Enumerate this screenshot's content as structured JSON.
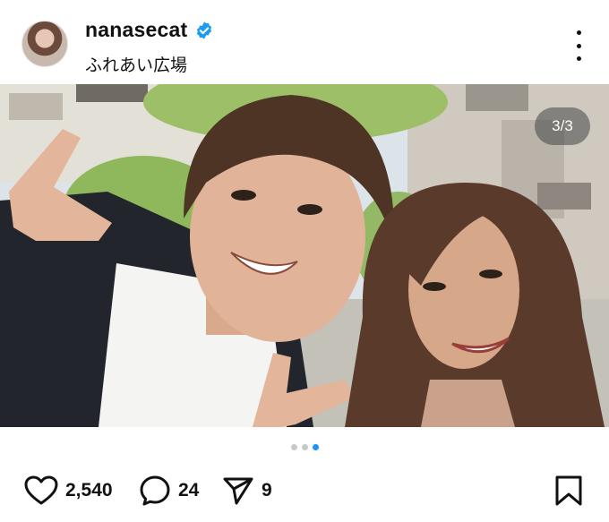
{
  "post": {
    "username": "nanasecat",
    "verified": true,
    "location": "ふれあい広場",
    "image_counter": "3/3",
    "carousel": {
      "total": 3,
      "current": 3
    }
  },
  "actions": {
    "likes": "2,540",
    "comments": "24",
    "shares": "9"
  },
  "icons": {
    "more": "more-options-icon",
    "like": "heart-icon",
    "comment": "comment-icon",
    "share": "send-icon",
    "save": "bookmark-icon",
    "verified": "verified-badge-icon"
  },
  "colors": {
    "verified_badge": "#1d9bf0",
    "active_dot": "#1e90ff"
  }
}
